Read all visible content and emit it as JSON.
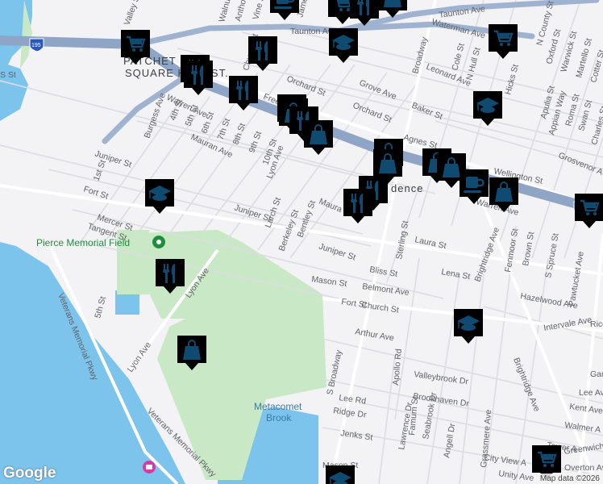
{
  "map": {
    "colors": {
      "background": "#f3f2f4",
      "water": "#7cc4ec",
      "park": "#c9e8c5",
      "highway": "#8ea5c6",
      "marker_fill": "#e4ecfb",
      "marker_border": "#6b93dd",
      "icon": "#0f4a70"
    },
    "neighborhood_labels": [
      "PATCHET FET",
      "SQUARE HIST. ST.",
      "dence"
    ],
    "poi_labels": {
      "park": "Pierce Memorial Field",
      "brook_line1": "Metacomet",
      "brook_line2": "Brook"
    },
    "highway_shields": [
      "195",
      "195"
    ],
    "streets": [
      "Taunton Ave",
      "Waterman Ave",
      "Broadway",
      "Grove Ave",
      "Orchard St",
      "Orchard St",
      "Baker St",
      "Leonard Ave",
      "Cole St",
      "N Hull St",
      "Hicks St",
      "N County St",
      "Oxford St",
      "Warwick St",
      "Martello St",
      "Cotter St",
      "Apulia St",
      "Appian Way",
      "Roma St",
      "Swan St",
      "Charles St",
      "Grosvenor Ave",
      "Wellington St",
      "Agnes St",
      "Warren Ave",
      "Warren Ave",
      "Burgess Ave",
      "4th St",
      "5th St",
      "6th St",
      "7th St",
      "8th St",
      "9th St",
      "10th St",
      "Lyon Ave",
      "Mauran Ave",
      "Juniper St",
      "Juniper St",
      "Juniper St",
      "Fort St",
      "Mercer St",
      "Tangent St",
      "1st St",
      "Larch St",
      "Berkeley St",
      "Bentley St",
      "Maura",
      "Laura St",
      "Bliss St",
      "Lena St",
      "Mason St",
      "Belmont Ave",
      "Hazelwood Ave",
      "Fort St",
      "Church St",
      "Arthur Ave",
      "S Broadway",
      "Brightridge Ave",
      "Brightridge Ave",
      "Fenmoor St",
      "Brown St",
      "S Spruce St",
      "Pawtucket Ave",
      "Intervale Ave",
      "Valleybrook Dr",
      "Brookhaven Dr",
      "Apollo Rd",
      "Lee Rd",
      "Ridge Dr",
      "Jenks St",
      "Famum St",
      "Lawrence Dr",
      "Seabrook Dr",
      "Angell Dr",
      "Grassmere Ave",
      "Lyon Ave",
      "Lyon Ave",
      "Veterans Memorial Pkwy",
      "Veterans Memorial Pkwy",
      "5th St",
      "Walnut St",
      "Anthony St",
      "Vine St",
      "James St",
      "Church St",
      "Free",
      "Gardin",
      "Lee Av",
      "Kent Ave",
      "Walmer A",
      "Tower A",
      "Greenwich",
      "City View A",
      "Unity Ave",
      "Overton Av",
      "Mason St",
      "Rice",
      "Sterling St",
      "Valley St",
      "S St"
    ],
    "markers": [
      {
        "type": "shopping-cart"
      },
      {
        "type": "cafe"
      },
      {
        "type": "shopping-cart"
      },
      {
        "type": "restaurant"
      },
      {
        "type": "shopping-bag"
      },
      {
        "type": "school"
      },
      {
        "type": "restaurant"
      },
      {
        "type": "restaurant"
      },
      {
        "type": "restaurant"
      },
      {
        "type": "restaurant"
      },
      {
        "type": "shopping-bag"
      },
      {
        "type": "shopping-bag"
      },
      {
        "type": "restaurant"
      },
      {
        "type": "shopping-bag"
      },
      {
        "type": "shopping-bag"
      },
      {
        "type": "shopping-bag"
      },
      {
        "type": "shopping-bag"
      },
      {
        "type": "shopping-bag"
      },
      {
        "type": "cafe"
      },
      {
        "type": "shopping-bag"
      },
      {
        "type": "school"
      },
      {
        "type": "shopping-cart"
      },
      {
        "type": "shopping-cart"
      },
      {
        "type": "restaurant"
      },
      {
        "type": "restaurant"
      },
      {
        "type": "school"
      },
      {
        "type": "restaurant"
      },
      {
        "type": "shopping-bag"
      },
      {
        "type": "school"
      },
      {
        "type": "shopping-cart"
      },
      {
        "type": "school"
      }
    ],
    "logo": "Google",
    "attribution": "Map data ©2026"
  }
}
